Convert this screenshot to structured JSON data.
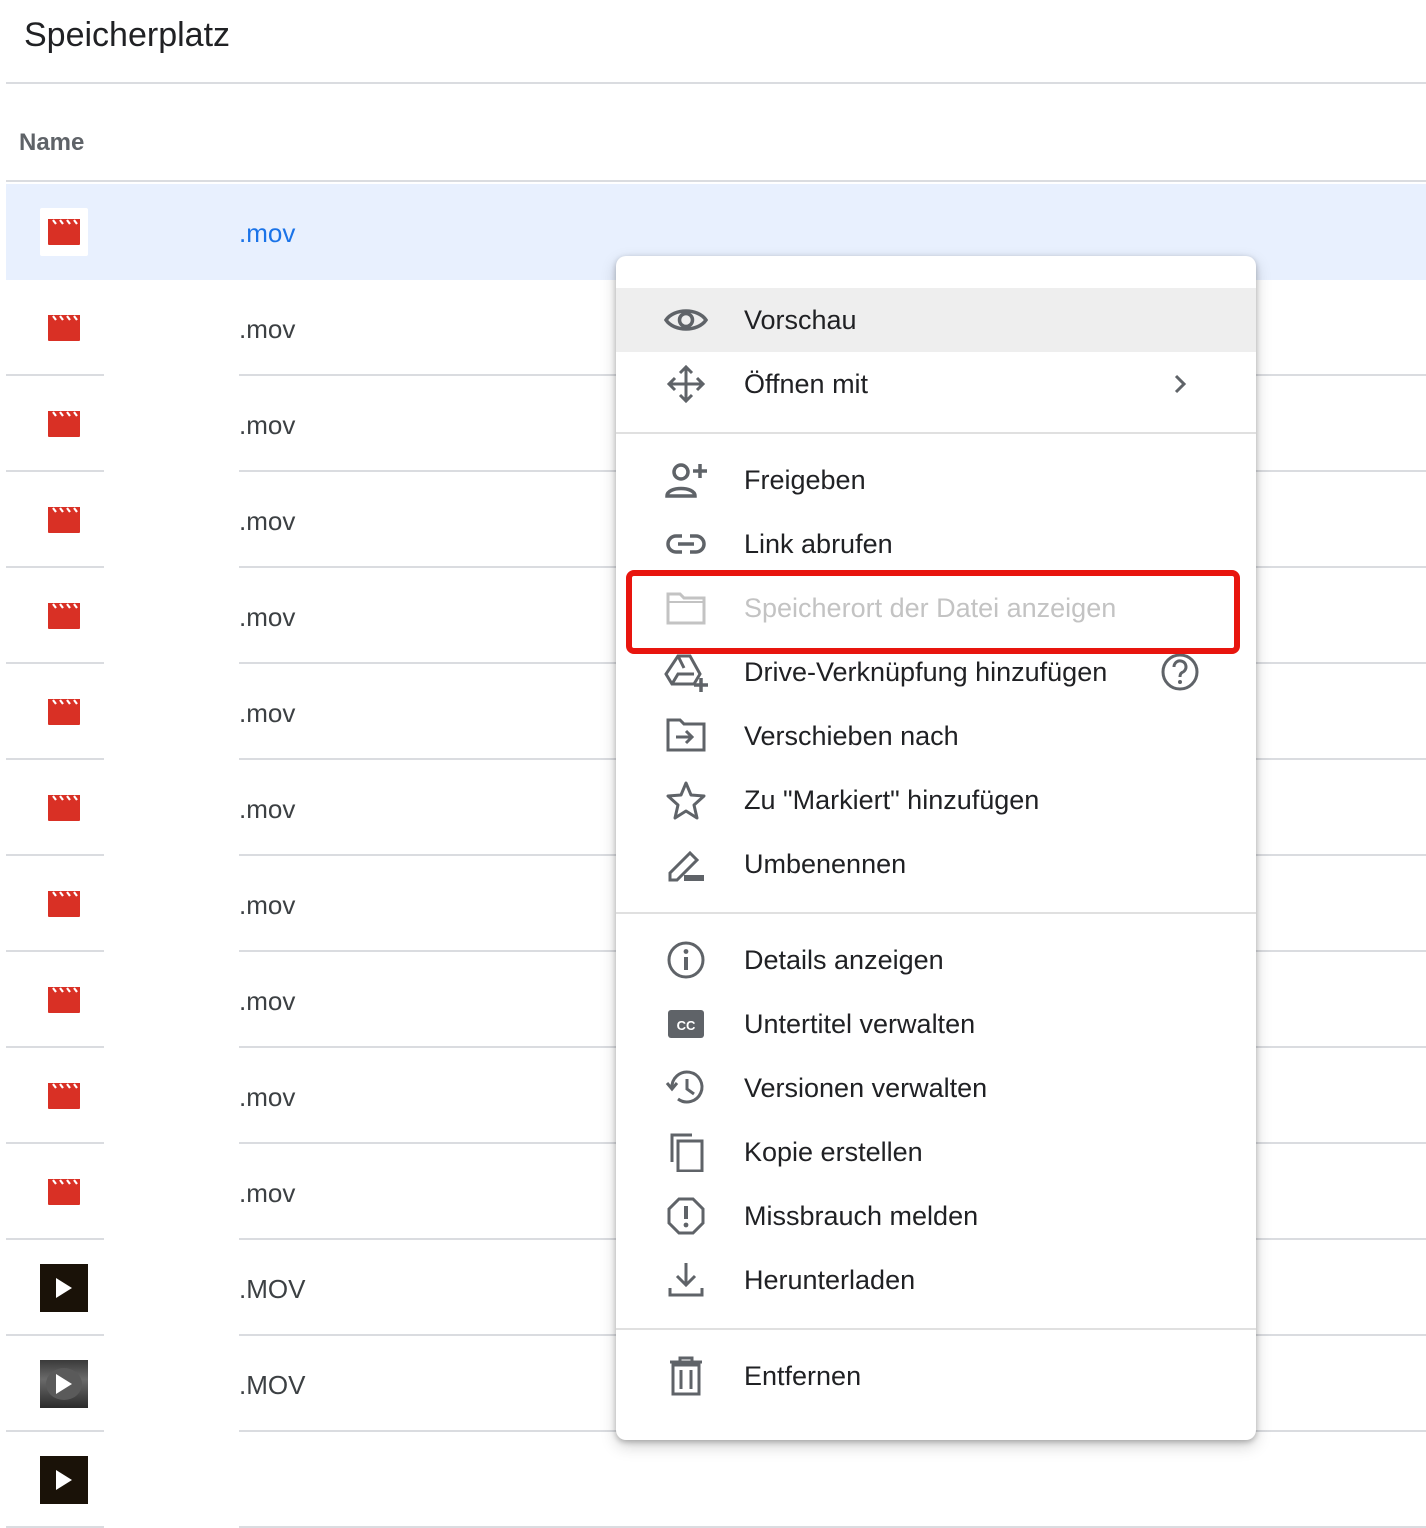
{
  "header": {
    "title": "Speicherplatz"
  },
  "table": {
    "column_name": "Name",
    "rows": [
      {
        "name": ".mov",
        "kind": "clapper",
        "selected": true
      },
      {
        "name": ".mov",
        "kind": "clapper"
      },
      {
        "name": ".mov",
        "kind": "clapper"
      },
      {
        "name": ".mov",
        "kind": "clapper"
      },
      {
        "name": ".mov",
        "kind": "clapper"
      },
      {
        "name": ".mov",
        "kind": "clapper"
      },
      {
        "name": ".mov",
        "kind": "clapper"
      },
      {
        "name": ".mov",
        "kind": "clapper"
      },
      {
        "name": ".mov",
        "kind": "clapper"
      },
      {
        "name": ".mov",
        "kind": "clapper"
      },
      {
        "name": ".mov",
        "kind": "clapper"
      },
      {
        "name": ".MOV",
        "kind": "thumb-dark"
      },
      {
        "name": ".MOV",
        "kind": "thumb-gray"
      },
      {
        "name": "",
        "kind": "thumb-dark"
      }
    ]
  },
  "menu": {
    "items": {
      "preview": "Vorschau",
      "open_with": "Öffnen mit",
      "share": "Freigeben",
      "get_link": "Link abrufen",
      "show_location": "Speicherort der Datei anzeigen",
      "add_shortcut": "Drive-Verknüpfung hinzufügen",
      "move_to": "Verschieben nach",
      "add_starred": "Zu \"Markiert\" hinzufügen",
      "rename": "Umbenennen",
      "details": "Details anzeigen",
      "captions": "Untertitel verwalten",
      "versions": "Versionen verwalten",
      "copy": "Kopie erstellen",
      "report": "Missbrauch melden",
      "download": "Herunterladen",
      "remove": "Entfernen"
    }
  },
  "colors": {
    "accent": "#1a73e8",
    "selected_row": "#e8f0fe",
    "video_icon": "#d93025",
    "highlight_border": "#e8150e",
    "icon_gray": "#5f6368"
  }
}
